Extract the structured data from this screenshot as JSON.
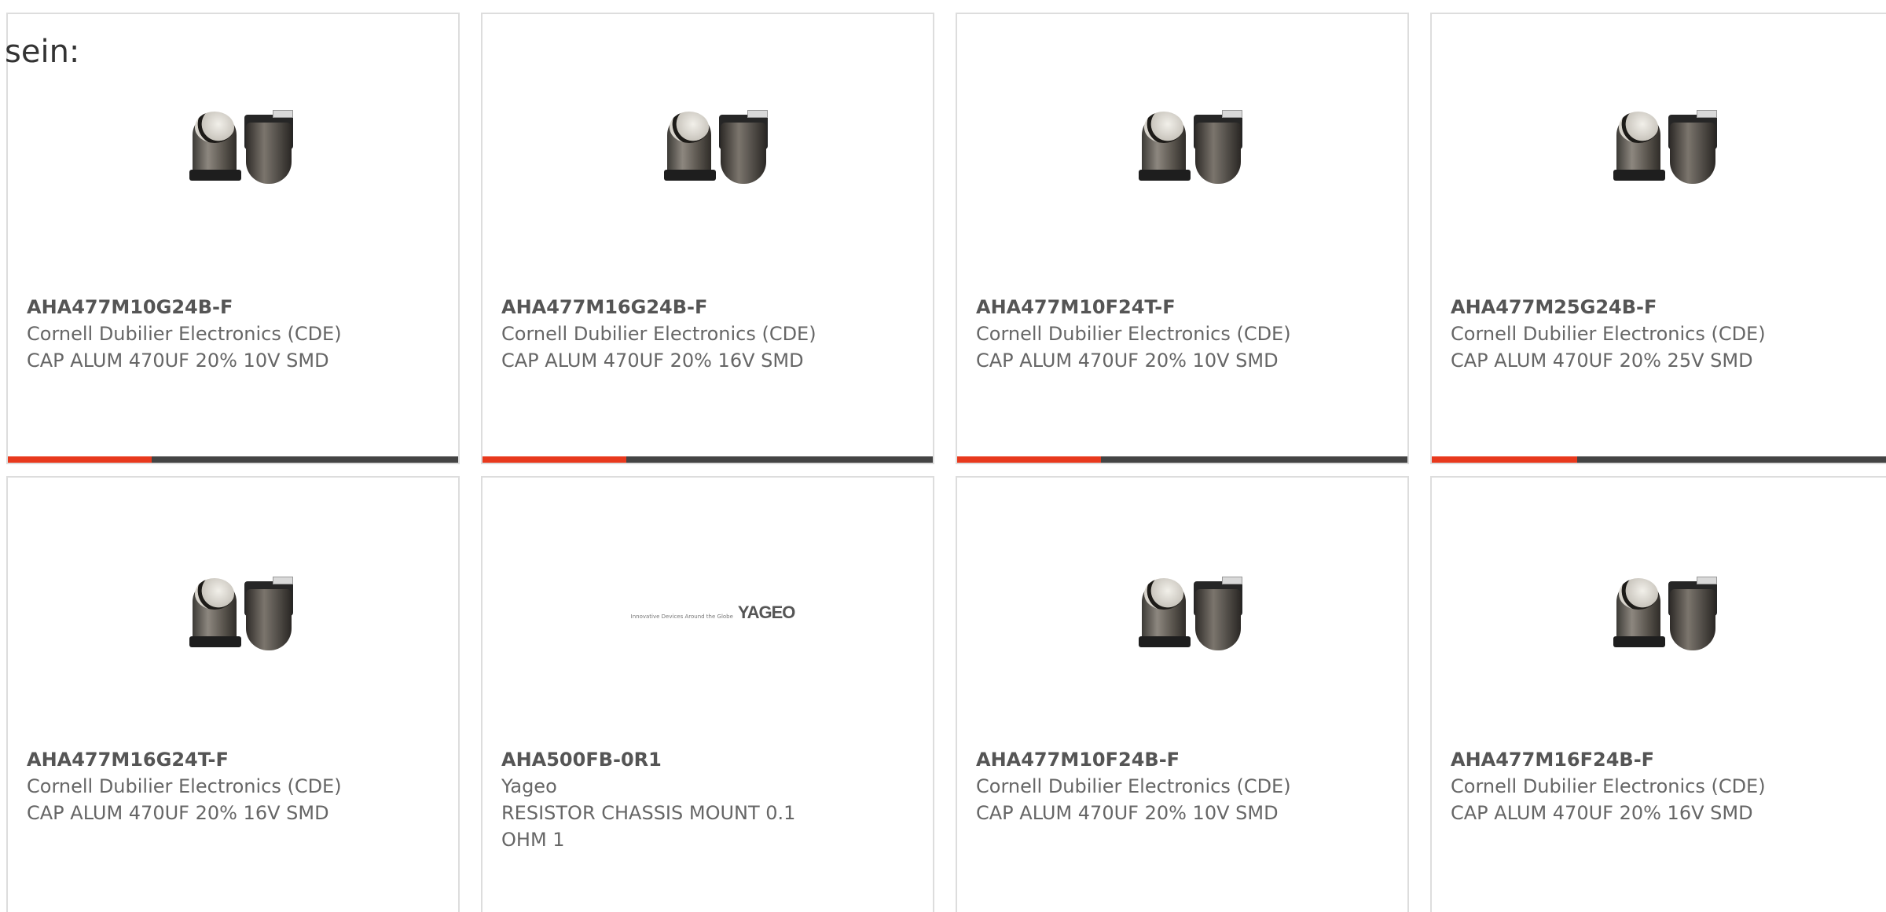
{
  "intro_text": "sein:",
  "products": [
    {
      "part": "AHA477M10G24B-F",
      "maker": "Cornell Dubilier Electronics (CDE)",
      "desc": "CAP ALUM 470UF 20% 10V SMD",
      "image": "capacitor",
      "progress": 0.32
    },
    {
      "part": "AHA477M16G24B-F",
      "maker": "Cornell Dubilier Electronics (CDE)",
      "desc": "CAP ALUM 470UF 20% 16V SMD",
      "image": "capacitor",
      "progress": 0.32
    },
    {
      "part": "AHA477M10F24T-F",
      "maker": "Cornell Dubilier Electronics (CDE)",
      "desc": "CAP ALUM 470UF 20% 10V SMD",
      "image": "capacitor",
      "progress": 0.32
    },
    {
      "part": "AHA477M25G24B-F",
      "maker": "Cornell Dubilier Electronics (CDE)",
      "desc": "CAP ALUM 470UF 20% 25V SMD",
      "image": "capacitor",
      "progress": 0.32
    },
    {
      "part": "AHA477M16G24T-F",
      "maker": "Cornell Dubilier Electronics (CDE)",
      "desc": "CAP ALUM 470UF 20% 16V SMD",
      "image": "capacitor"
    },
    {
      "part": "AHA500FB-0R1",
      "maker": "Yageo",
      "desc": "RESISTOR CHASSIS MOUNT 0.1 OHM 1",
      "image": "yageo-logo",
      "logo_tagline": "Innovative Devices Around the Globe",
      "logo_brand": "YAGEO"
    },
    {
      "part": "AHA477M10F24B-F",
      "maker": "Cornell Dubilier Electronics (CDE)",
      "desc": "CAP ALUM 470UF 20% 10V SMD",
      "image": "capacitor"
    },
    {
      "part": "AHA477M16F24B-F",
      "maker": "Cornell Dubilier Electronics (CDE)",
      "desc": "CAP ALUM 470UF 20% 16V SMD",
      "image": "capacitor"
    }
  ],
  "colors": {
    "accent": "#e8391d",
    "bar_track": "#444444",
    "border": "#dddddd",
    "text": "#666666"
  }
}
